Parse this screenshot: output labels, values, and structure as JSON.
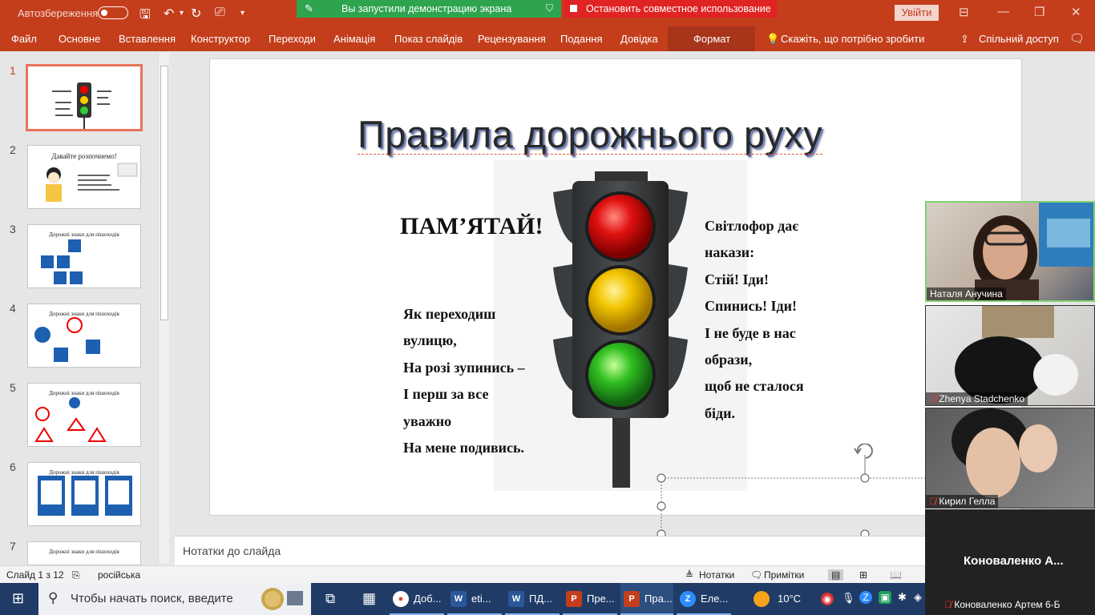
{
  "titlebar": {
    "autosave_label": "Автозбереження",
    "signin_label": "Увійти"
  },
  "share_bar": {
    "status": "Вы запустили демонстрацию экрана",
    "stop": "Остановить совместное использование"
  },
  "ribbon": {
    "tabs": [
      "Файл",
      "Основне",
      "Вставлення",
      "Конструктор",
      "Переходи",
      "Анімація",
      "Показ слайдів",
      "Рецензування",
      "Подання",
      "Довідка",
      "Формат"
    ],
    "tell_me": "Скажіть, що потрібно зробити",
    "share": "Спільний доступ"
  },
  "thumbnails": [
    {
      "num": "1",
      "title": ""
    },
    {
      "num": "2",
      "title": "Давайте розпочнемо!"
    },
    {
      "num": "3",
      "title": "Дорожні знаки для пішоходів"
    },
    {
      "num": "4",
      "title": "Дорожні знаки для пішоходів"
    },
    {
      "num": "5",
      "title": "Дорожні знаки для пішоходів"
    },
    {
      "num": "6",
      "title": "Дорожні знаки для пішоходів"
    },
    {
      "num": "7",
      "title": "Дорожні знаки для пішоходів"
    }
  ],
  "slide": {
    "title": "Правила дорожнього руху",
    "remember": "ПАМ’ЯТАЙ!",
    "poem_left": [
      "Як переходиш",
      "вулицю,",
      "На розі зупинись –",
      "І перш за все",
      "уважно",
      "На мене подивись."
    ],
    "poem_right": [
      "Світлофор дає",
      "накази:",
      "Стій! Іди!",
      "Спинись! Іди!",
      "І не буде в нас",
      "образи,",
      "щоб не сталося",
      "біди."
    ]
  },
  "notes_placeholder": "Нотатки до слайда",
  "status": {
    "slide_counter": "Слайд 1 з 12",
    "language": "російська",
    "notes": "Нотатки",
    "comments": "Примітки"
  },
  "taskbar": {
    "search_placeholder": "Чтобы начать поиск, введите",
    "apps": [
      {
        "icon": "chrome-icon",
        "label": "Доб..."
      },
      {
        "icon": "word-icon",
        "label": "eti..."
      },
      {
        "icon": "word-icon",
        "label": "ПД..."
      },
      {
        "icon": "powerpoint-icon",
        "label": "Пре..."
      },
      {
        "icon": "powerpoint-icon",
        "label": "Пра..."
      },
      {
        "icon": "zoom-icon",
        "label": "Еле..."
      }
    ],
    "temperature": "10°C"
  },
  "participants": [
    {
      "name": "Наталя Анучина",
      "muted": false
    },
    {
      "name": "Zhenya Stadchenko",
      "muted": true
    },
    {
      "name": "Кирил Гелла",
      "muted": true
    }
  ],
  "participant_noncam": {
    "big_name": "Коноваленко А...",
    "full_name": "Коноваленко Артем 6-Б"
  }
}
